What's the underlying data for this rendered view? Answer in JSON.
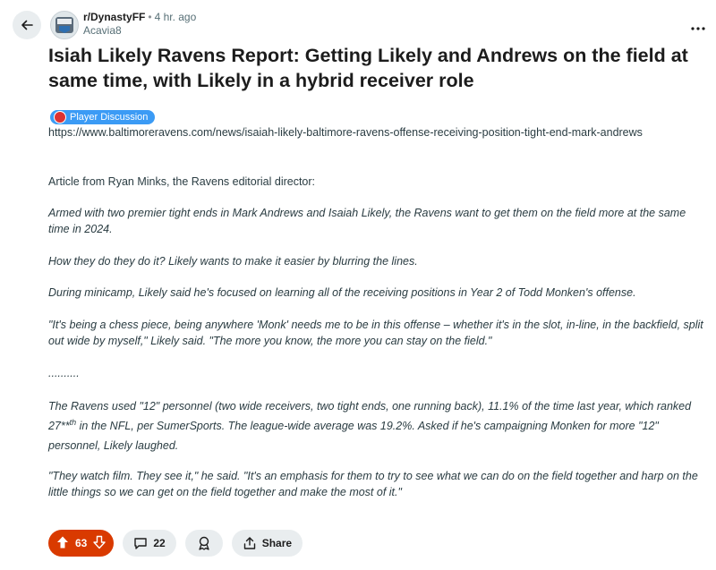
{
  "header": {
    "subreddit": "r/DynastyFF",
    "separator": "•",
    "time": "4 hr. ago",
    "username": "Acavia8"
  },
  "post": {
    "title": "Isiah Likely Ravens Report: Getting Likely and Andrews on the field at same time, with Likely in a hybrid receiver role",
    "flair": "Player Discussion",
    "link": "https://www.baltimoreravens.com/news/isaiah-likely-baltimore-ravens-offense-receiving-position-tight-end-mark-andrews",
    "p1": "Article from Ryan Minks, the Ravens editorial director:",
    "p2": "Armed with two premier tight ends in Mark Andrews and Isaiah Likely, the Ravens want to get them on the field more at the same time in 2024.",
    "p3": "How they do they do it? Likely wants to make it easier by blurring the lines.",
    "p4": "During minicamp, Likely said he's focused on learning all of the receiving positions in Year 2 of Todd Monken's offense.",
    "p5": "\"It's being a chess piece, being anywhere 'Monk' needs me to be in this offense – whether it's in the slot, in-line, in the backfield, split out wide by myself,\" Likely said. \"The more you know, the more you can stay on the field.\"",
    "p6": "..........",
    "p7a": "The Ravens used \"12\" personnel (two wide receivers, two tight ends, one running back), 11.1% of the time last year, which ranked 27**",
    "p7sup": "th",
    "p7b": " in the NFL, per SumerSports. The league-wide average was 19.2%. Asked if he's campaigning Monken for more \"12\" personnel, Likely laughed.",
    "p8": "\"They watch film. They see it,\" he said. \"It's an emphasis for them to try to see what we can do on the field together and harp on the little things so we can get on the field together and make the most of it.\""
  },
  "actions": {
    "votes": "63",
    "comments": "22",
    "share": "Share"
  },
  "icons": {
    "back": "arrow-left-icon",
    "upvote": "upvote-icon",
    "downvote": "downvote-icon",
    "comment": "comment-icon",
    "award": "award-icon",
    "share": "share-icon",
    "more": "more-icon"
  }
}
